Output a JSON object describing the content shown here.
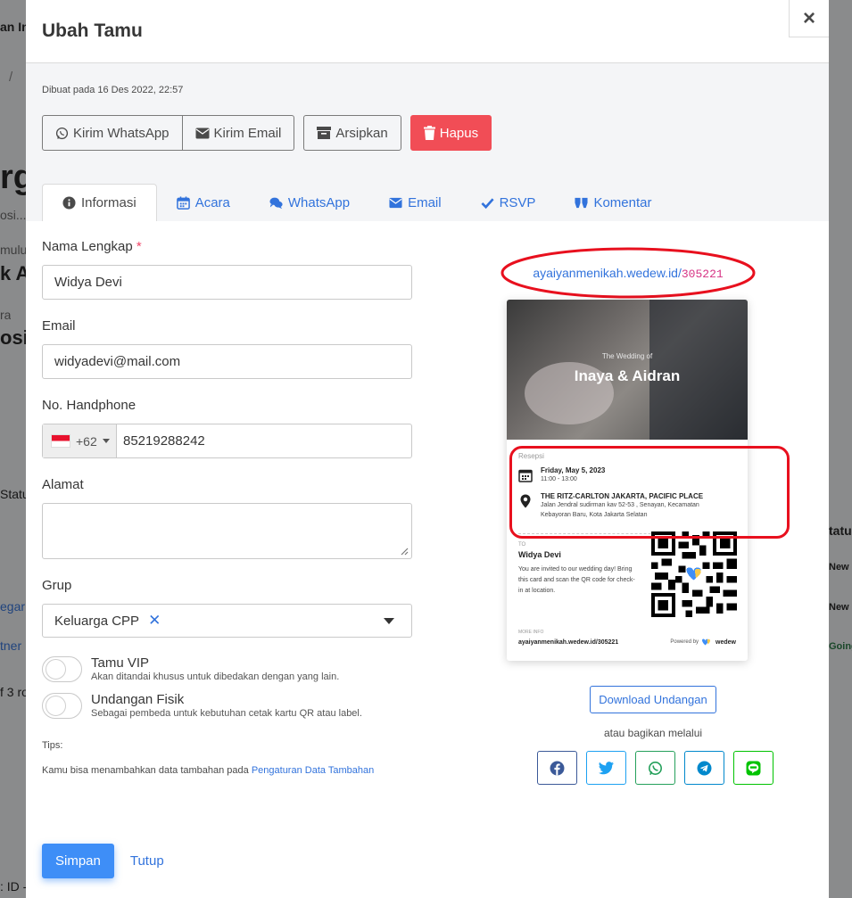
{
  "modal": {
    "title": "Ubah Tamu",
    "close_label": "×",
    "created": "Dibuat pada 16 Des 2022, 22:57"
  },
  "actions": {
    "whatsapp": "Kirim WhatsApp",
    "email": "Kirim Email",
    "archive": "Arsipkan",
    "delete": "Hapus"
  },
  "tabs": [
    {
      "label": "Informasi",
      "icon": "info-icon",
      "active": true
    },
    {
      "label": "Acara",
      "icon": "calendar-icon"
    },
    {
      "label": "WhatsApp",
      "icon": "chat-icon"
    },
    {
      "label": "Email",
      "icon": "envelope-icon"
    },
    {
      "label": "RSVP",
      "icon": "check-icon"
    },
    {
      "label": "Komentar",
      "icon": "quote-icon"
    }
  ],
  "form": {
    "name_label": "Nama Lengkap",
    "required_mark": "*",
    "name_value": "Widya Devi",
    "email_label": "Email",
    "email_value": "widyadevi@mail.com",
    "phone_label": "No. Handphone",
    "phone_code": "+62",
    "phone_value": "85219288242",
    "address_label": "Alamat",
    "address_value": "",
    "group_label": "Grup",
    "group_value": "Keluarga CPP",
    "group_remove": "✕",
    "vip_title": "Tamu VIP",
    "vip_desc": "Akan ditandai khusus untuk dibedakan dengan yang lain.",
    "physical_title": "Undangan Fisik",
    "physical_desc": "Sebagai pembeda untuk kebutuhan cetak kartu QR atau label.",
    "tips_title": "Tips:",
    "tips_text": "Kamu bisa menambahkan data tambahan pada ",
    "tips_link": "Pengaturan Data Tambahan"
  },
  "footer": {
    "save": "Simpan",
    "close": "Tutup"
  },
  "preview": {
    "url_base": "ayaiyanmenikah.wedew.id/",
    "url_code": "305221",
    "hero_sub": "The Wedding of",
    "hero_name": "Inaya & Aidran",
    "section": "Resepsi",
    "date": "Friday, May 5, 2023",
    "time": "11:00 - 13:00",
    "venue": "THE RITZ-CARLTON JAKARTA, PACIFIC PLACE",
    "address_line1": "Jalan Jendral sudirman kav 52-53 , Senayan, Kecamatan",
    "address_line2": "Kebayoran Baru, Kota Jakarta Selatan",
    "to_label": "TO",
    "guest_name": "Widya Devi",
    "invite_msg": "You are invited to our wedding day! Bring this card and scan the QR code for check-in at location.",
    "more_label": "MORE INFO",
    "more_url": "ayaiyanmenikah.wedew.id/305221",
    "powered_by": "Powered by",
    "brand": "wedew",
    "download": "Download Undangan",
    "share_label": "atau bagikan melalui"
  },
  "share_buttons": [
    {
      "icon": "facebook-icon",
      "color": "#3b5998"
    },
    {
      "icon": "twitter-icon",
      "color": "#1da1f2"
    },
    {
      "icon": "whatsapp-icon",
      "color": "#25a05b"
    },
    {
      "icon": "telegram-icon",
      "color": "#0088cc"
    },
    {
      "icon": "line-icon",
      "color": "#00c300"
    }
  ],
  "background": {
    "frag_title": "rga",
    "frag_sub": "osi...",
    "frag_a": "mulu",
    "frag_b": "k Ak",
    "frag_c": "ra",
    "frag_d": "osi",
    "frag_status": "Statu",
    "frag_status_r": "tatu",
    "frag_new1": "New",
    "frag_new2": "New",
    "frag_going": "Going",
    "frag_egar": "egar",
    "frag_tner": "tner",
    "frag_ro": "f 3 ro",
    "frag_id": ": ID -",
    "frag_top": "an In",
    "frag_crumb": "/"
  }
}
